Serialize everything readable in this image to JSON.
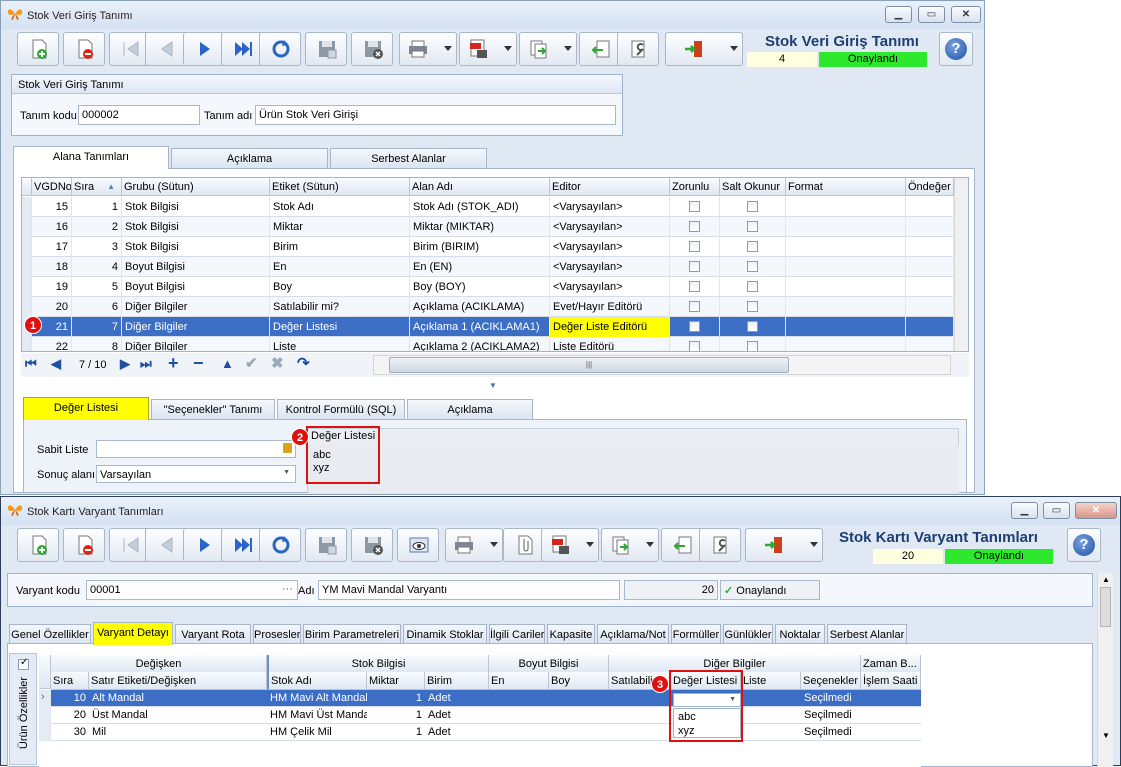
{
  "top_window": {
    "title": "Stok Veri Giriş Tanımı",
    "header_title": "Stok Veri Giriş Tanımı",
    "count": "4",
    "status": "Onaylandı",
    "group_title": "Stok Veri Giriş Tanımı",
    "tanim_kodu_label": "Tanım kodu",
    "tanim_kodu": "000002",
    "tanim_adi_label": "Tanım adı",
    "tanim_adi": "Ürün Stok Veri Girişi",
    "tabs": [
      "Alana Tanımları",
      "Açıklama",
      "Serbest Alanlar"
    ],
    "columns": [
      "VGDNo",
      "Sıra",
      "Grubu (Sütun)",
      "Etiket (Sütun)",
      "Alan Adı",
      "Editor",
      "Zorunlu",
      "Salt Okunur",
      "Format",
      "Öndeğer"
    ],
    "rows": [
      [
        "15",
        "1",
        "Stok Bilgisi",
        "Stok Adı",
        "Stok Adı (STOK_ADI)",
        "<Varysayılan>"
      ],
      [
        "16",
        "2",
        "Stok Bilgisi",
        "Miktar",
        "Miktar (MIKTAR)",
        "<Varysayılan>"
      ],
      [
        "17",
        "3",
        "Stok Bilgisi",
        "Birim",
        "Birim (BIRIM)",
        "<Varysayılan>"
      ],
      [
        "18",
        "4",
        "Boyut Bilgisi",
        "En",
        "En (EN)",
        "<Varysayılan>"
      ],
      [
        "19",
        "5",
        "Boyut Bilgisi",
        "Boy",
        "Boy (BOY)",
        "<Varysayılan>"
      ],
      [
        "20",
        "6",
        "Diğer Bilgiler",
        "Satılabilir mi?",
        "Açıklama (ACIKLAMA)",
        "Evet/Hayır Editörü"
      ],
      [
        "21",
        "7",
        "Diğer Bilgiler",
        "Değer Listesi",
        "Açıklama 1 (ACIKLAMA1)",
        "Değer Liste Editörü"
      ],
      [
        "22",
        "8",
        "Diğer Bilgiler",
        "Liste",
        "Açıklama 2 (ACIKLAMA2)",
        "Liste Editörü"
      ]
    ],
    "nav_position": "7 / 10",
    "badge1": "1",
    "sub_tabs": [
      "Değer Listesi",
      "\"Seçenekler\" Tanımı",
      "Kontrol Formülü (SQL)",
      "Açıklama"
    ],
    "sabit_liste_label": "Sabit Liste",
    "sonuc_alani_label": "Sonuç alanı",
    "sonuc_alani": "Varsayılan",
    "deger_listesi_label": "Değer Listesi",
    "deger_listesi_items": [
      "abc",
      "xyz"
    ],
    "badge2": "2"
  },
  "bottom_window": {
    "title": "Stok Kartı Varyant Tanımları",
    "header_title": "Stok Kartı Varyant Tanımları",
    "count": "20",
    "status": "Onaylandı",
    "varyant_kodu_label": "Varyant kodu",
    "varyant_kodu": "00001",
    "adi_label": "Adı",
    "adi": "YM Mavi Mandal Varyantı",
    "count_field": "20",
    "status_field": "Onaylandı",
    "tabs": [
      "Genel Özellikler",
      "Varyant Detayı",
      "Varyant Rota",
      "Prosesler",
      "Birim Parametreleri",
      "Dinamik Stoklar",
      "İlgili Cariler",
      "Kapasite",
      "Açıklama/Not",
      "Formüller",
      "Günlükler",
      "Noktalar",
      "Serbest Alanlar"
    ],
    "band_headers": [
      "Değişken",
      "Stok Bilgisi",
      "Boyut Bilgisi",
      "Diğer Bilgiler",
      "Zaman B..."
    ],
    "columns": [
      "Sıra",
      "Satır Etiketi/Değişken",
      "Stok Adı",
      "Miktar",
      "Birim",
      "En",
      "Boy",
      "Satılabilir",
      "Değer Listesi",
      "Liste",
      "Seçenekler",
      "İşlem Saati"
    ],
    "rows": [
      [
        "10",
        "Alt Mandal",
        "HM Mavi Alt Mandal",
        "1",
        "Adet",
        "",
        "",
        "",
        "",
        "",
        "Seçilmedi",
        ""
      ],
      [
        "20",
        "Üst Mandal",
        "HM Mavi Üst Mandal",
        "1",
        "Adet",
        "",
        "",
        "",
        "",
        "",
        "Seçilmedi",
        ""
      ],
      [
        "30",
        "Mil",
        "HM Çelik Mil",
        "1",
        "Adet",
        "",
        "",
        "",
        "",
        "",
        "Seçilmedi",
        ""
      ]
    ],
    "side_label": "Ürün Özellikler",
    "dropdown_items": [
      "abc",
      "xyz"
    ],
    "badge3": "3"
  },
  "colors": {
    "status_green": "#2ee82e",
    "selection": "#3d6ec6",
    "highlight_yellow": "#ffff00",
    "badge_red": "#e01010"
  }
}
